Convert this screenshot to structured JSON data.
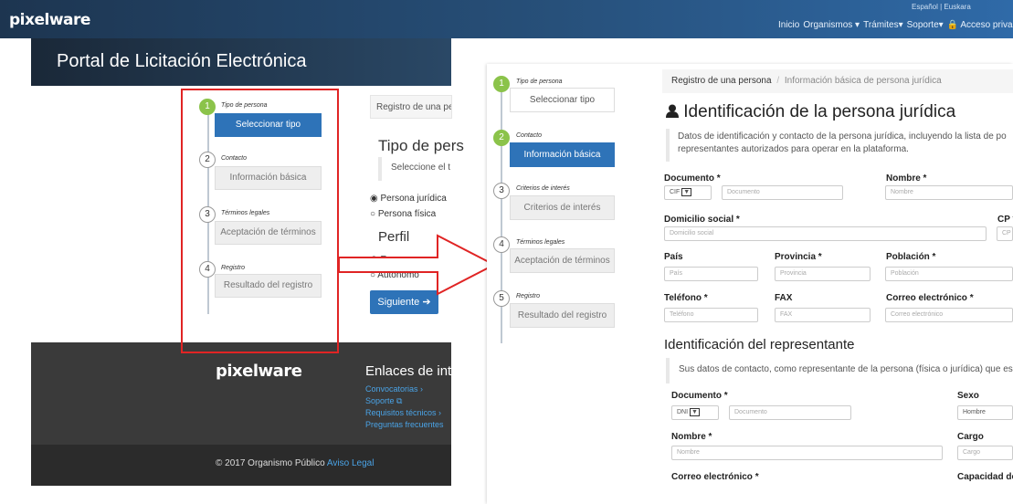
{
  "left": {
    "brand": "pixelware",
    "lang": "Español | Euskara",
    "nav": [
      "Inicio",
      "Organismos ▾",
      "Trámites▾",
      "Soporte▾",
      "🔒 Acceso privado"
    ],
    "portal_title": "Portal de Licitación Electrónica",
    "steps": [
      {
        "num": "1",
        "label": "Tipo de persona",
        "box": "Seleccionar tipo"
      },
      {
        "num": "2",
        "label": "Contacto",
        "box": "Información básica"
      },
      {
        "num": "3",
        "label": "Términos legales",
        "box": "Aceptación de términos"
      },
      {
        "num": "4",
        "label": "Registro",
        "box": "Resultado del registro"
      }
    ],
    "breadcrumb": "Registro de una pe",
    "heading": "Tipo de pers",
    "hint": "Seleccione el t",
    "radios_tipo": [
      "Persona jurídica",
      "Persona física"
    ],
    "perfil_title": "Perfil",
    "radios_perfil": [
      "Empresa",
      "Autónomo"
    ],
    "next_button": "Siguiente ➔",
    "footer_brand": "pixelware",
    "footer_links_title": "Enlaces de int",
    "footer_links": [
      "Convocatorias ›",
      "Soporte ⧉",
      "Requisitos técnicos ›",
      "Preguntas frecuentes"
    ],
    "copyright": "© 2017 Organismo Público",
    "legal_link": "Aviso Legal"
  },
  "right": {
    "steps": [
      {
        "num": "1",
        "label": "Tipo de persona",
        "box": "Seleccionar tipo"
      },
      {
        "num": "2",
        "label": "Contacto",
        "box": "Información básica"
      },
      {
        "num": "3",
        "label": "Criterios de interés",
        "box": "Criterios de interés"
      },
      {
        "num": "4",
        "label": "Términos legales",
        "box": "Aceptación de términos"
      },
      {
        "num": "5",
        "label": "Registro",
        "box": "Resultado del registro"
      }
    ],
    "breadcrumb_1": "Registro de una persona",
    "breadcrumb_sep": "/",
    "breadcrumb_2": "Información básica de persona jurídica",
    "heading": "Identificación de la persona jurídica",
    "intro": "Datos de identificación y contacto de la persona jurídica, incluyendo la lista de po representantes autorizados para operar en la plataforma.",
    "documento_label": "Documento *",
    "documento_type": "CIF",
    "documento_placeholder": "Documento",
    "nombre_label": "Nombre *",
    "nombre_placeholder": "Nombre",
    "domicilio_label": "Domicilio social *",
    "domicilio_placeholder": "Domicilio social",
    "cp_label": "CP *",
    "cp_placeholder": "CP",
    "pais_label": "País",
    "pais_placeholder": "País",
    "provincia_label": "Provincia *",
    "provincia_placeholder": "Provincia",
    "poblacion_label": "Población *",
    "poblacion_placeholder": "Población",
    "telefono_label": "Teléfono *",
    "telefono_placeholder": "Teléfono",
    "fax_label": "FAX",
    "fax_placeholder": "FAX",
    "correo_label": "Correo electrónico *",
    "correo_placeholder": "Correo electrónico",
    "rep_heading": "Identificación del representante",
    "rep_intro": "Sus datos de contacto, como representante de la persona (física o jurídica) que es",
    "rep_documento_label": "Documento *",
    "rep_documento_type": "DNI",
    "rep_documento_placeholder": "Documento",
    "sexo_label": "Sexo",
    "sexo_value": "Hombre",
    "rep_nombre_label": "Nombre *",
    "rep_nombre_placeholder": "Nombre",
    "cargo_label": "Cargo",
    "cargo_placeholder": "Cargo",
    "rep_correo_label": "Correo electrónico *",
    "capacidad_label": "Capacidad de"
  },
  "colors": {
    "accent": "#2e73b8",
    "highlight": "#e02424",
    "step_active": "#8bc34a"
  }
}
